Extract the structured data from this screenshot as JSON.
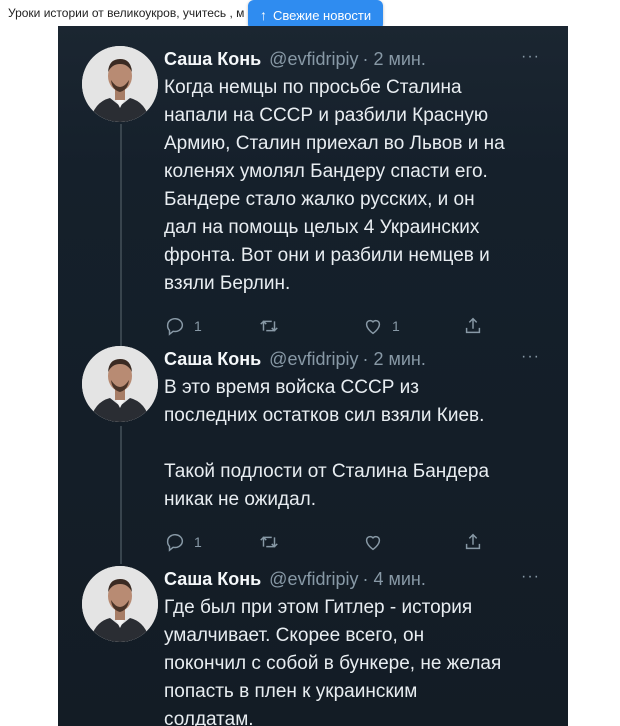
{
  "header": {
    "caption": "Уроки истории от великоукров, учитесь , м",
    "news_button": "Свежие новости"
  },
  "tweets": [
    {
      "name": "Саша Конь",
      "handle": "@evfidripiy",
      "time": "· 2 мин.",
      "more": "···",
      "text": "Когда немцы по просьбе Сталина\nнапали на СССР и разбили Красную\nАрмию, Сталин приехал во Львов и на\nколенях умолял Бандеру спасти его.\nБандере стало жалко русских, и он\nдал на помощь целых 4 Украинских\nфронта. Вот они и разбили немцев и\nвзяли Берлин.",
      "reply_count": "1",
      "retweet_count": "",
      "like_count": "1"
    },
    {
      "name": "Саша Конь",
      "handle": "@evfidripiy",
      "time": "· 2 мин.",
      "more": "···",
      "text": "В это время войска СССР из\nпоследних остатков сил взяли Киев.\n\nТакой подлости от Сталина Бандера\nникак не ожидал.",
      "reply_count": "1",
      "retweet_count": "",
      "like_count": ""
    },
    {
      "name": "Саша Конь",
      "handle": "@evfidripiy",
      "time": "· 4 мин.",
      "more": "···",
      "text": "Где был при этом Гитлер - история\nумалчивает. Скорее всего, он\nпокончил с собой в бункере, не желая\nпопасть в плен к украинским\nсолдатам."
    }
  ],
  "colors": {
    "background": "#15202b",
    "text": "#e8edf1",
    "secondary": "#8899a6",
    "accent": "#2f8cf0"
  },
  "icons": [
    "reply-icon",
    "retweet-icon",
    "like-icon",
    "share-icon",
    "arrow-up-icon"
  ]
}
